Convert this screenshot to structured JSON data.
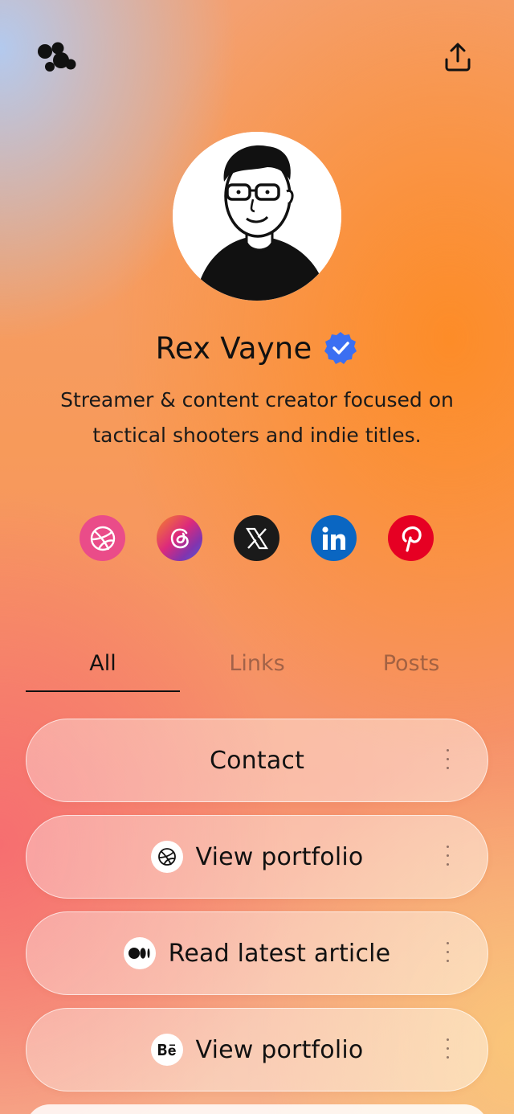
{
  "header": {
    "logo_icon": "bubbles-logo-icon",
    "share_icon": "share-upload-icon"
  },
  "profile": {
    "name": "Rex Vayne",
    "verified": true,
    "verified_color": "#3B6FF2",
    "bio": "Streamer & content creator focused on tactical shooters and indie titles."
  },
  "socials": [
    {
      "name": "dribbble",
      "icon": "dribbble-icon",
      "color": "#EA4C89"
    },
    {
      "name": "threads",
      "icon": "threads-icon",
      "color": "#C13584"
    },
    {
      "name": "x",
      "icon": "x-icon",
      "color": "#1A1A1A"
    },
    {
      "name": "linkedin",
      "icon": "linkedin-icon",
      "color": "#0A66C2"
    },
    {
      "name": "pinterest",
      "icon": "pinterest-icon",
      "color": "#E60023"
    }
  ],
  "tabs": [
    {
      "label": "All",
      "active": true
    },
    {
      "label": "Links",
      "active": false
    },
    {
      "label": "Posts",
      "active": false
    }
  ],
  "links": [
    {
      "label": "Contact",
      "icon": null
    },
    {
      "label": "View portfolio",
      "icon": "dribbble-icon"
    },
    {
      "label": "Read latest article",
      "icon": "medium-icon"
    },
    {
      "label": "View portfolio",
      "icon": "behance-icon"
    }
  ]
}
